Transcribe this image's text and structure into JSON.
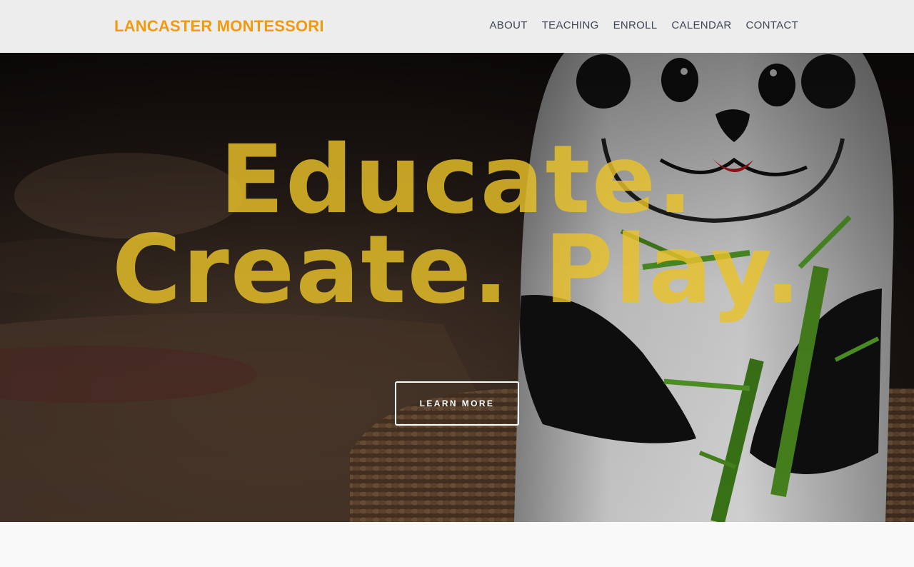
{
  "header": {
    "logo": "LANCASTER MONTESSORI",
    "nav": [
      "ABOUT",
      "TEACHING",
      "ENROLL",
      "CALENDAR",
      "CONTACT"
    ]
  },
  "hero": {
    "line1": "Educate.",
    "line2": "Create. Play.",
    "cta": "LEARN MORE"
  },
  "colors": {
    "logo": "#f29a0d",
    "headline": "#e9c22a",
    "nav": "#3d4656",
    "header_bg": "#ededed"
  }
}
